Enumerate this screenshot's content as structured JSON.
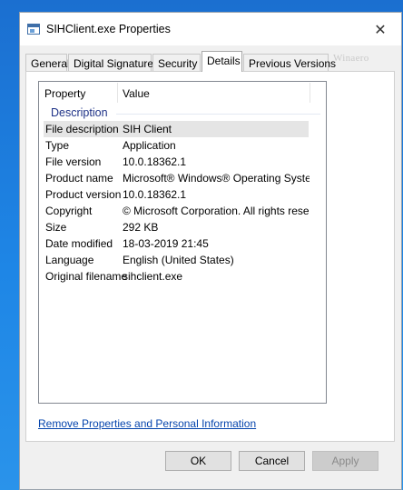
{
  "window": {
    "title": "SIHClient.exe Properties",
    "close_glyph": "✕",
    "icon": "properties-window-icon"
  },
  "tabs": [
    {
      "label": "General",
      "active": false
    },
    {
      "label": "Digital Signatures",
      "active": false
    },
    {
      "label": "Security",
      "active": false
    },
    {
      "label": "Details",
      "active": true
    },
    {
      "label": "Previous Versions",
      "active": false
    }
  ],
  "watermark": "Winaero",
  "list": {
    "columns": {
      "property": "Property",
      "value": "Value"
    },
    "group": "Description",
    "rows": [
      {
        "name": "File description",
        "value": "SIH Client"
      },
      {
        "name": "Type",
        "value": "Application"
      },
      {
        "name": "File version",
        "value": "10.0.18362.1"
      },
      {
        "name": "Product name",
        "value": "Microsoft® Windows® Operating System"
      },
      {
        "name": "Product version",
        "value": "10.0.18362.1"
      },
      {
        "name": "Copyright",
        "value": "© Microsoft Corporation. All rights reserv..."
      },
      {
        "name": "Size",
        "value": "292 KB"
      },
      {
        "name": "Date modified",
        "value": "18-03-2019 21:45"
      },
      {
        "name": "Language",
        "value": "English (United States)"
      },
      {
        "name": "Original filename",
        "value": "sihclient.exe"
      }
    ]
  },
  "link": "Remove Properties and Personal Information",
  "buttons": {
    "ok": "OK",
    "cancel": "Cancel",
    "apply": "Apply"
  },
  "colors": {
    "accent": "#1e3287",
    "link": "#0645ad",
    "desktop": "#1e86e6"
  }
}
